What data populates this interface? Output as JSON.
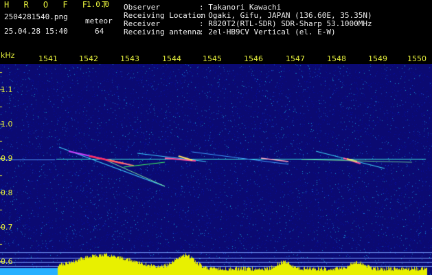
{
  "header": {
    "app_title": "H R O F F T",
    "version": "1.0.0",
    "filename": "2504281540.png",
    "datetime": "25.04.28 15:40",
    "counter_label": "meteor",
    "counter_value": "64",
    "fields": [
      {
        "label": "Observer",
        "value": ": Takanori Kawachi"
      },
      {
        "label": "Receiving Location",
        "value": ": Ogaki, Gifu, JAPAN (136.60E, 35.35N)"
      },
      {
        "label": "Receiver",
        "value": ": R820T2(RTL-SDR) SDR-Sharp 53.1000MHz"
      },
      {
        "label": "Receiving antenna",
        "value": ": 2el-HB9CV Vertical (el. E-W)"
      }
    ]
  },
  "spectrogram": {
    "freq_unit": "kHz",
    "freq_ticks": [
      "1.1",
      "1.0",
      "0.9",
      "0.8",
      "0.7",
      "0.6"
    ],
    "time_ticks": [
      "1541",
      "1542",
      "1543",
      "1544",
      "1545",
      "1546",
      "1547",
      "1548",
      "1549",
      "1550"
    ],
    "colors": {
      "label": "#e6f03c",
      "background": "#0b0a72",
      "carrier": "#3ff0e0",
      "activity": "#e8f000"
    }
  }
}
